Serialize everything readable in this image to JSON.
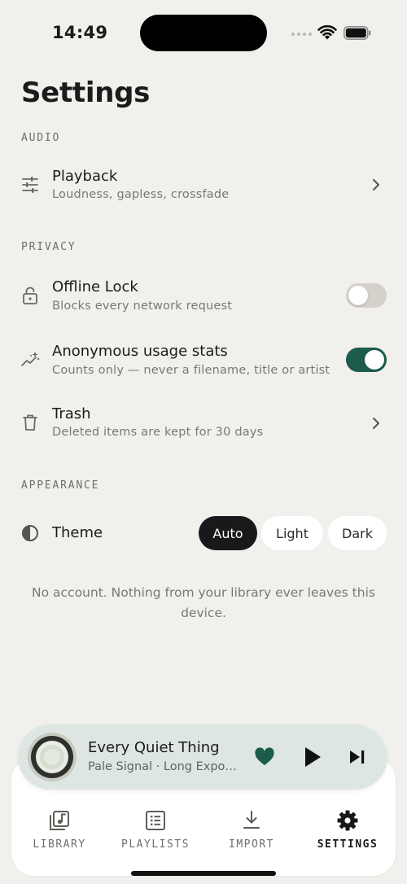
{
  "status": {
    "time": "14:49"
  },
  "title": "Settings",
  "sections": {
    "audio": "AUDIO",
    "privacy": "PRIVACY",
    "appearance": "APPEARANCE"
  },
  "rows": {
    "playback": {
      "title": "Playback",
      "subtitle": "Loudness, gapless, crossfade",
      "icon": "sliders-icon"
    },
    "offline_lock": {
      "title": "Offline Lock",
      "subtitle": "Blocks every network request",
      "icon": "lock-icon",
      "enabled": false
    },
    "usage_stats": {
      "title": "Anonymous usage stats",
      "subtitle": "Counts only — never a filename, title or artist",
      "icon": "chart-sparkle-icon",
      "enabled": true
    },
    "trash": {
      "title": "Trash",
      "subtitle": "Deleted items are kept for 30 days",
      "icon": "trash-icon"
    }
  },
  "theme": {
    "label": "Theme",
    "options": [
      "Auto",
      "Light",
      "Dark"
    ],
    "selected": "Auto"
  },
  "footer_note": "No account. Nothing from your library ever leaves this device.",
  "now_playing": {
    "title": "Every Quiet Thing",
    "subtitle": "Pale Signal · Long Exposure",
    "liked": true
  },
  "tabs": [
    {
      "label": "LIBRARY",
      "icon": "music-library-icon"
    },
    {
      "label": "PLAYLISTS",
      "icon": "list-icon"
    },
    {
      "label": "IMPORT",
      "icon": "download-icon"
    },
    {
      "label": "SETTINGS",
      "icon": "gear-icon",
      "active": true
    }
  ],
  "colors": {
    "background": "#f1f0ec",
    "accent": "#1d5b4a",
    "mini_player": "#dde6e2"
  }
}
